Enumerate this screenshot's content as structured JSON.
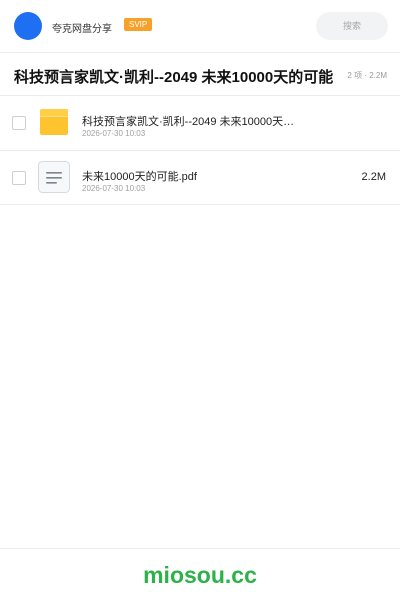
{
  "header": {
    "share_name": "夸克网盘分享",
    "vip_label": "SVIP",
    "search_label": "搜索",
    "accent_color": "#1e6ff2",
    "vip_color": "#f7a12b"
  },
  "folder": {
    "title": "科技预言家凯文·凯利--2049 未来10000天的可能",
    "meta": "2 项 · 2.2M"
  },
  "files": [
    {
      "name": "科技预言家凯文·凯利--2049 未来10000天…",
      "date": "2026-07-30 10:03",
      "size": "",
      "icon": "folder-icon"
    },
    {
      "name": "未来10000天的可能.pdf",
      "date": "2026-07-30 10:03",
      "size": "2.2M",
      "icon": "document-icon"
    }
  ],
  "watermark": {
    "text": "miosou.cc",
    "color": "#2db24a"
  }
}
